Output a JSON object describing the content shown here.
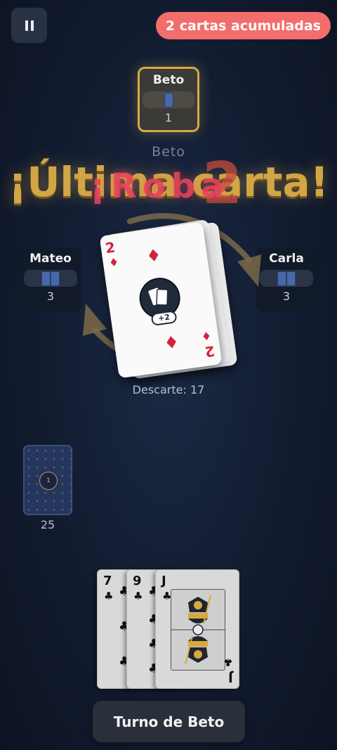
{
  "status": {
    "pending_draw": "2 cartas acumuladas"
  },
  "players": {
    "top": {
      "name": "Beto",
      "card_count": "1"
    },
    "left": {
      "name": "Mateo",
      "card_count": "3"
    },
    "right": {
      "name": "Carla",
      "card_count": "3"
    }
  },
  "ghost_name": "Beto",
  "announcements": {
    "last_card": "¡Última carta!",
    "draw": "¡Roba",
    "draw_amount": "2"
  },
  "discard": {
    "top_card": {
      "rank": "2",
      "suit": "♦",
      "effect": "+2"
    },
    "label": "Descarte: 17"
  },
  "draw_pile": {
    "center_label": "1",
    "count": "25"
  },
  "hand": [
    {
      "rank": "7",
      "suit": "♣"
    },
    {
      "rank": "9",
      "suit": "♣"
    },
    {
      "rank": "J",
      "suit": "♣",
      "face": "J"
    }
  ],
  "turn_button": "Turno de Beto",
  "icons": {
    "pause": "pause-icon",
    "effect": "draw-cards-icon",
    "direction": "direction-arrows-icon"
  },
  "colors": {
    "highlight": "#d5a84b",
    "badge": "#f26d6b",
    "announce_gold": "#e3b248",
    "announce_red": "#e7445b",
    "card_red": "#d2233a"
  }
}
